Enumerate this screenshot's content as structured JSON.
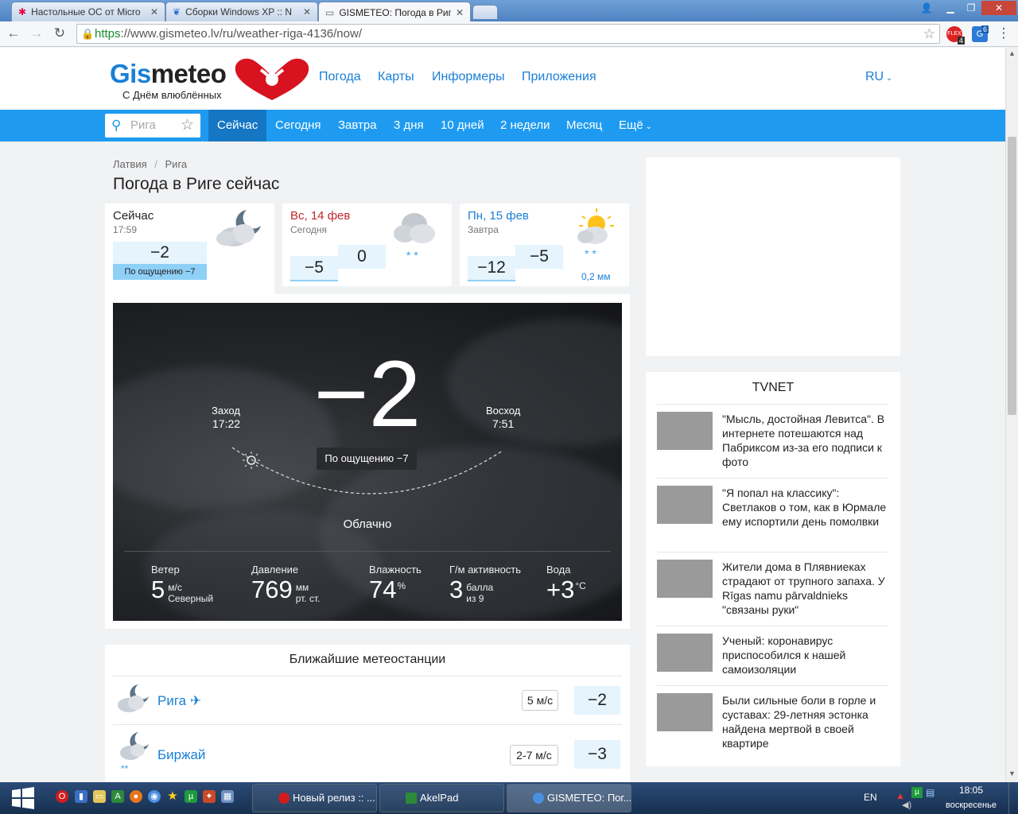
{
  "browser": {
    "tabs": [
      {
        "title": "Настольные ОС от Micro"
      },
      {
        "title": "Сборки Windows XP :: N"
      },
      {
        "title": "GISMETEO: Погода в Риге"
      }
    ],
    "url_scheme": "https",
    "url_rest": "://www.gismeteo.lv/ru/weather-riga-4136/now/",
    "ext_badge_1": "4",
    "ext_badge_2": "6"
  },
  "header": {
    "logo_a": "Gis",
    "logo_b": "meteo",
    "tagline": "С Днём влюблённых",
    "nav": [
      "Погода",
      "Карты",
      "Информеры",
      "Приложения"
    ],
    "lang": "RU"
  },
  "bluebar": {
    "search_placeholder": "Рига",
    "items": [
      "Сейчас",
      "Сегодня",
      "Завтра",
      "3 дня",
      "10 дней",
      "2 недели",
      "Месяц",
      "Ещё"
    ]
  },
  "breadcrumb": [
    "Латвия",
    "Рига"
  ],
  "page_title": "Погода в Риге сейчас",
  "now_card": {
    "label": "Сейчас",
    "time": "17:59",
    "temp": "−2",
    "feels": "По ощущению −7"
  },
  "day1": {
    "date": "Вс, 14 фев",
    "label": "Сегодня",
    "low": "−5",
    "high": "0"
  },
  "day2": {
    "date": "Пн, 15 фев",
    "label": "Завтра",
    "low": "−12",
    "high": "−5",
    "precip": "0,2 мм"
  },
  "hero": {
    "temp": "−2",
    "feels": "По ощущению −7",
    "sunset_label": "Заход",
    "sunset_time": "17:22",
    "sunrise_label": "Восход",
    "sunrise_time": "7:51",
    "condition": "Облачно",
    "stats": [
      {
        "label": "Ветер",
        "value": "5",
        "unit1": "м/с",
        "unit2": "Северный"
      },
      {
        "label": "Давление",
        "value": "769",
        "unit1": "мм",
        "unit2": "рт. ст."
      },
      {
        "label": "Влажность",
        "value": "74",
        "unit1": "%",
        "unit2": ""
      },
      {
        "label": "Г/м активность",
        "value": "3",
        "unit1": "балла",
        "unit2": "из 9"
      },
      {
        "label": "Вода",
        "value": "+3",
        "unit1": "°C",
        "unit2": ""
      }
    ]
  },
  "stations": {
    "title": "Ближайшие метеостанции",
    "list": [
      {
        "name": "Рига",
        "wind": "5 м/с",
        "temp": "−2"
      },
      {
        "name": "Биржай",
        "wind": "2-7 м/с",
        "temp": "−3"
      }
    ]
  },
  "news": {
    "source": "TVNET",
    "items": [
      {
        "text": "\"Мысль, достойная Левитса\". В интернете потешаются над Пабриксом из-за его подписи к фото"
      },
      {
        "text": "\"Я попал на классику\": Светлаков о том, как в Юрмале ему испортили день помолвки"
      },
      {
        "text": "Жители дома в Плявниеках страдают от трупного запаха. У Rīgas namu pārvaldnieks \"связаны руки\""
      },
      {
        "text": "Ученый: коронавирус приспособился к нашей самоизоляции"
      },
      {
        "text": "Были сильные боли в горле и суставах: 29-летняя эстонка найдена мертвой в своей квартире"
      }
    ]
  },
  "taskbar": {
    "buttons": [
      "Новый релиз :: ...",
      "AkelPad",
      "GISMETEO: Пог..."
    ],
    "lang": "EN",
    "time": "18:05",
    "day": "воскресенье"
  }
}
